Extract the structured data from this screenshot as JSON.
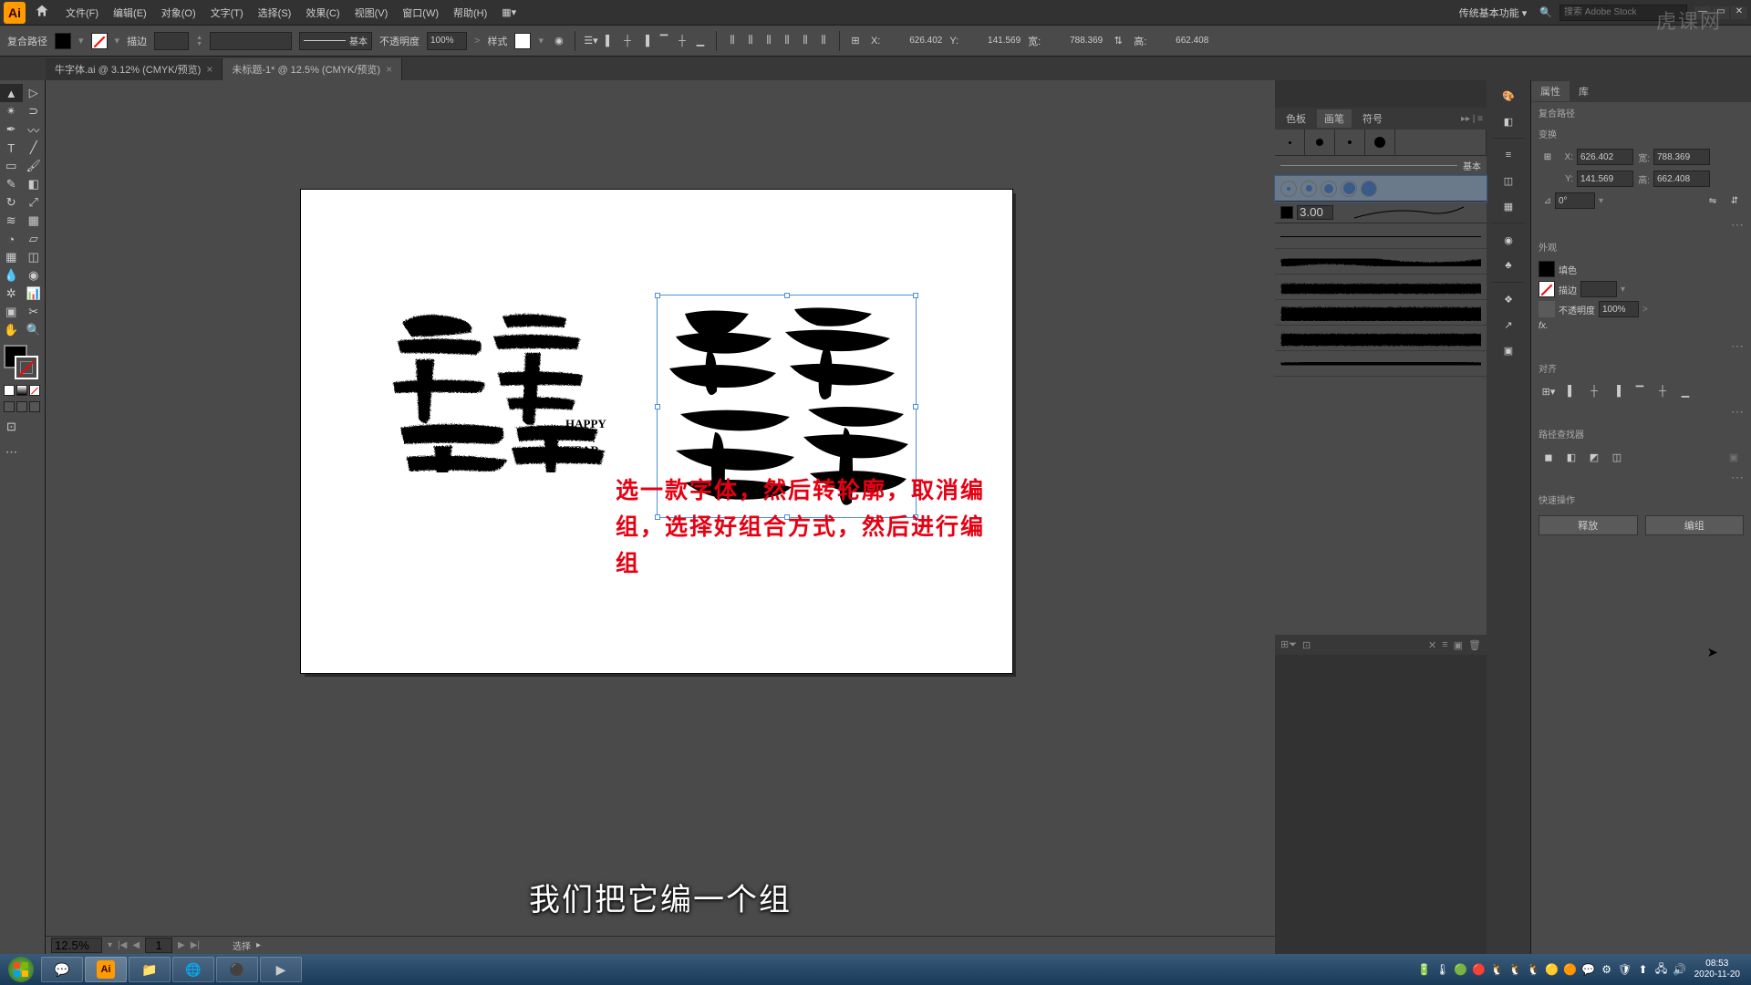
{
  "menubar": {
    "items": [
      "文件(F)",
      "编辑(E)",
      "对象(O)",
      "文字(T)",
      "选择(S)",
      "效果(C)",
      "视图(V)",
      "窗口(W)",
      "帮助(H)"
    ],
    "workspace": "传统基本功能",
    "search_placeholder": "搜索 Adobe Stock"
  },
  "controlbar": {
    "selection_type": "复合路径",
    "stroke_label": "描边",
    "stroke_pt": "",
    "brush_label": "基本",
    "opacity_label": "不透明度",
    "opacity_value": "100%",
    "style_label": "样式",
    "x_label": "X:",
    "x_value": "626.402",
    "y_label": "Y:",
    "y_value": "141.569",
    "w_label": "宽:",
    "w_value": "788.369",
    "h_label": "高:",
    "h_value": "662.408"
  },
  "tabs": {
    "items": [
      {
        "label": "牛字体.ai @ 3.12% (CMYK/预览)"
      },
      {
        "label": "未标题-1* @ 12.5% (CMYK/预览)"
      }
    ]
  },
  "canvas": {
    "happy_text": "HAPPY\nNIU\nYEAR",
    "red_text": "选一款字体，然后转轮廓，取消编组，选择好组合方式，然后进行编组",
    "subtitle": "我们把它编一个组"
  },
  "brushes_panel": {
    "tabs": [
      "色板",
      "画笔",
      "符号"
    ],
    "basic_label": "基本",
    "size_value": "3.00"
  },
  "properties": {
    "tabs": [
      "属性",
      "库"
    ],
    "object_type": "复合路径",
    "transform_title": "变换",
    "x_label": "X:",
    "x_value": "626.402",
    "y_label": "Y:",
    "y_value": "141.569",
    "w_label": "宽:",
    "w_value": "788.369",
    "h_label": "高:",
    "h_value": "662.408",
    "angle_value": "0°",
    "appearance_title": "外观",
    "fill_label": "填色",
    "stroke_label": "描边",
    "opacity_label": "不透明度",
    "opacity_value": "100%",
    "fx_label": "fx.",
    "align_title": "对齐",
    "pathfinder_title": "路径查找器",
    "quick_title": "快速操作",
    "quick_release": "释放",
    "quick_edit": "编组"
  },
  "statusbar": {
    "zoom": "12.5%",
    "page": "1",
    "mode": "选择"
  },
  "taskbar": {
    "time": "08:53",
    "date": "2020-11-20"
  },
  "watermark": "虎课网"
}
